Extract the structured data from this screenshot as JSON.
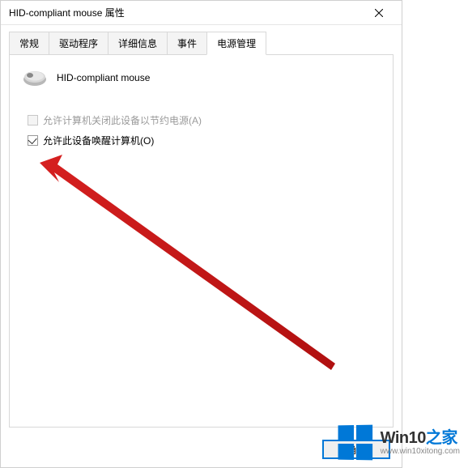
{
  "window": {
    "title": "HID-compliant mouse 属性"
  },
  "tabs": {
    "general": "常规",
    "driver": "驱动程序",
    "details": "详细信息",
    "events": "事件",
    "power": "电源管理"
  },
  "device": {
    "name": "HID-compliant mouse"
  },
  "options": {
    "allow_off": {
      "label": "允许计算机关闭此设备以节约电源(A)",
      "checked": false,
      "enabled": false
    },
    "allow_wake": {
      "label": "允许此设备唤醒计算机(O)",
      "checked": true,
      "enabled": true
    }
  },
  "buttons": {
    "ok": "确定"
  },
  "watermark": {
    "brand_en": "Win10",
    "brand_zh": "之家",
    "url": "www.win10xitong.com"
  }
}
